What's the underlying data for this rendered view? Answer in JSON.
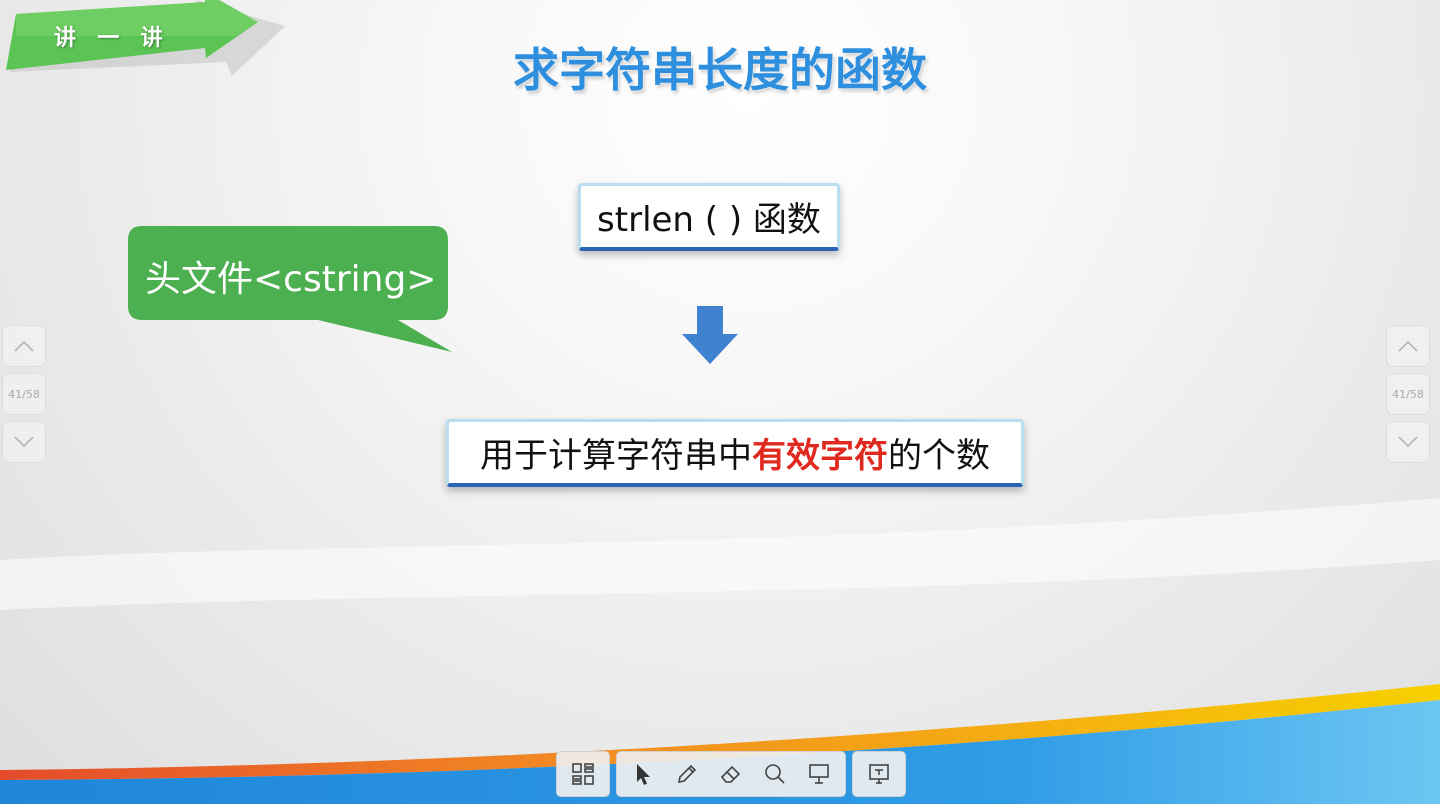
{
  "badge": {
    "label": "讲  一  讲"
  },
  "slide": {
    "title": "求字符串长度的函数",
    "function_box": "strlen ( ) 函数",
    "callout": "头文件<cstring>",
    "desc": {
      "before": "用于计算字符串中",
      "highlight": "有效字符",
      "after": "的个数"
    }
  },
  "nav": {
    "page_indicator": "41/58",
    "up_icon": "chevron-up-icon",
    "down_icon": "chevron-down-icon"
  },
  "toolbar": {
    "icons": [
      "grid-icon",
      "pointer-icon",
      "pen-icon",
      "eraser-icon",
      "search-icon",
      "comment-icon",
      "screen-icon"
    ]
  },
  "colors": {
    "title": "#2d8fde",
    "highlight": "#e02a1f",
    "callout": "#4caf50",
    "arrow": "#3f82d0",
    "badge": "#5cc455"
  }
}
